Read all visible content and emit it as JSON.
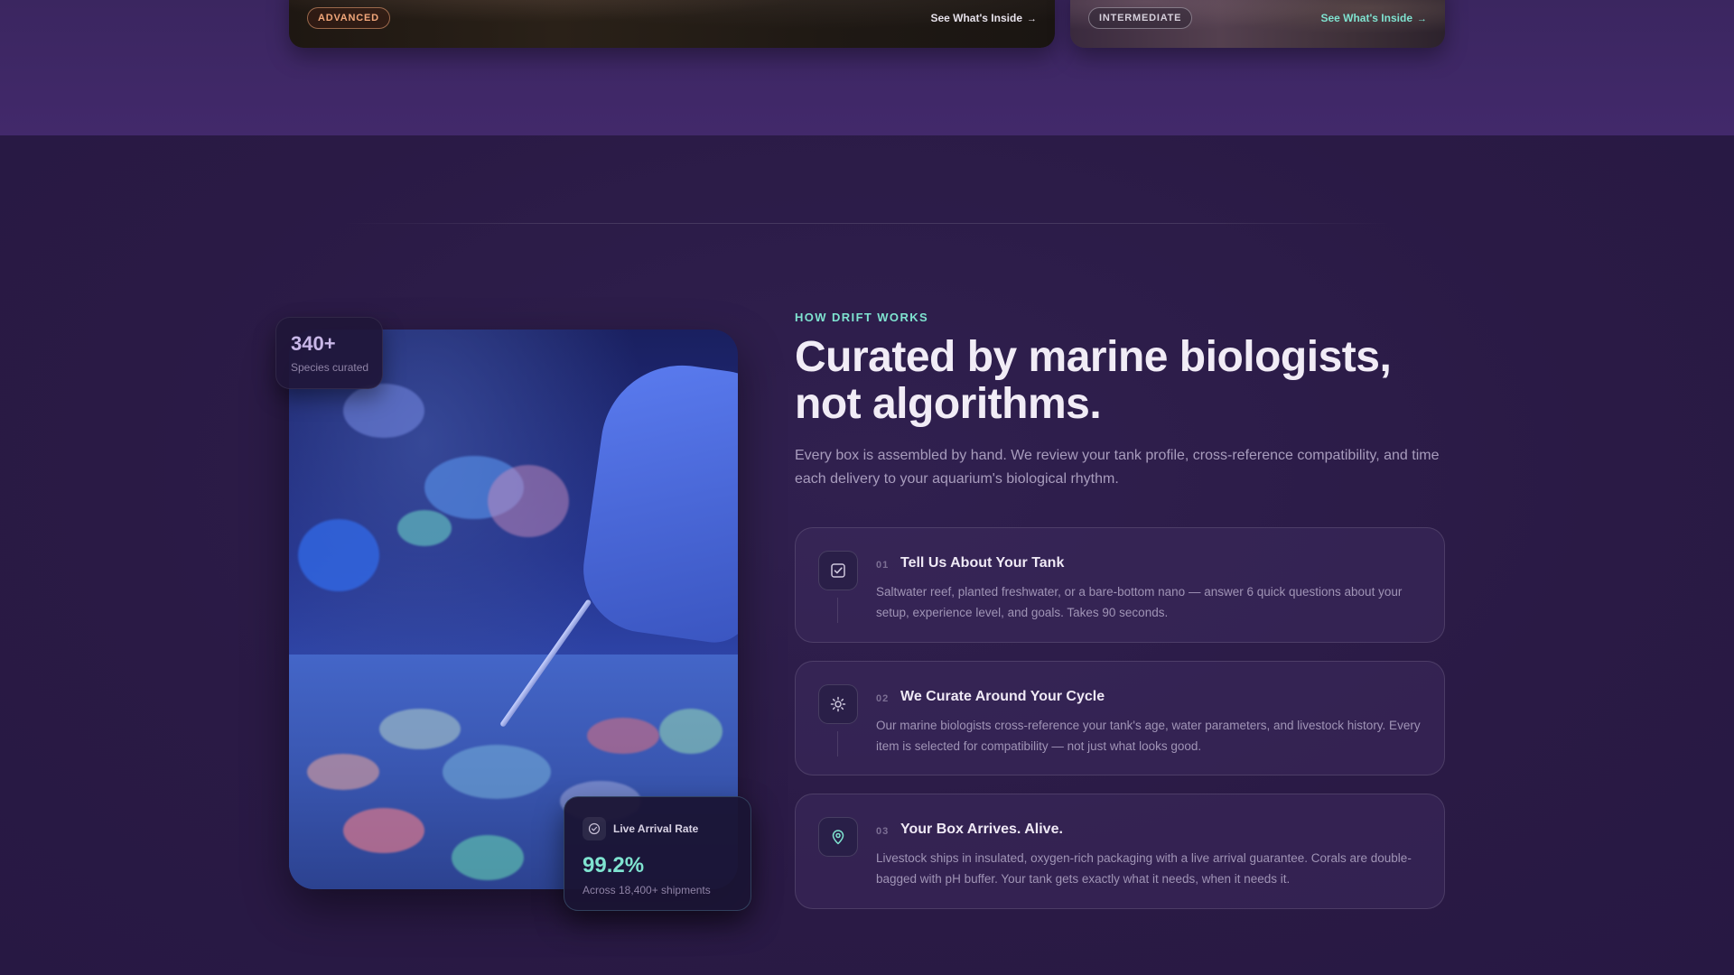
{
  "top_cards": [
    {
      "badge": "ADVANCED",
      "link": "See What's Inside"
    },
    {
      "badge": "INTERMEDIATE",
      "link": "See What's Inside"
    }
  ],
  "stats": {
    "species_count": "340+",
    "species_label": "Species curated"
  },
  "arrival": {
    "title": "Live Arrival Rate",
    "rate": "99.2%",
    "subtitle": "Across 18,400+ shipments"
  },
  "section": {
    "eyebrow": "HOW DRIFT WORKS",
    "headline": "Curated by marine biologists, not algorithms.",
    "lede": "Every box is assembled by hand. We review your tank profile, cross-reference compatibility, and time each delivery to your aquarium's biological rhythm."
  },
  "steps": [
    {
      "number": "01",
      "title": "Tell Us About Your Tank",
      "description": "Saltwater reef, planted freshwater, or a bare-bottom nano — answer 6 quick questions about your setup, experience level, and goals. Takes 90 seconds.",
      "icon": "checkbox-icon"
    },
    {
      "number": "02",
      "title": "We Curate Around Your Cycle",
      "description": "Our marine biologists cross-reference your tank's age, water parameters, and livestock history. Every item is selected for compatibility — not just what looks good.",
      "icon": "sun-icon"
    },
    {
      "number": "03",
      "title": "Your Box Arrives. Alive.",
      "description": "Livestock ships in insulated, oxygen-rich packaging with a live arrival guarantee. Corals are double-bagged with pH buffer. Your tank gets exactly what it needs, when it needs it.",
      "icon": "location-pin-icon"
    }
  ],
  "colors": {
    "accent": "#7fe3d0",
    "advanced_badge": "#f2a77a",
    "background": "#2a1a45"
  }
}
